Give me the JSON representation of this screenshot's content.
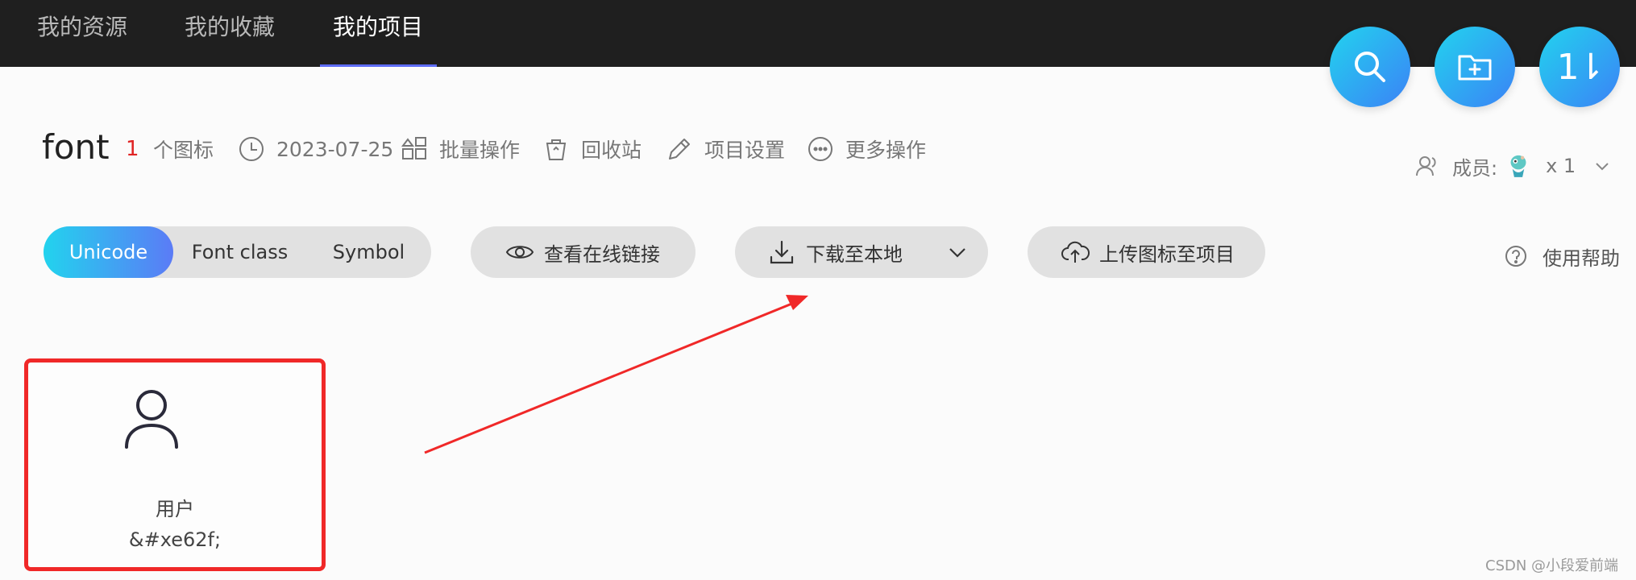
{
  "nav": {
    "tabs": [
      {
        "label": "我的资源"
      },
      {
        "label": "我的收藏"
      },
      {
        "label": "我的项目"
      }
    ],
    "active_tab": "我的项目"
  },
  "fabs": [
    {
      "icon": "search-icon"
    },
    {
      "icon": "add-folder-icon"
    },
    {
      "icon": "sort-icon",
      "glyph": "1⇂"
    }
  ],
  "project": {
    "name": "font",
    "icon_count": "1",
    "icon_count_unit": "个图标",
    "date": "2023-07-25",
    "batch_label": "批量操作",
    "recycle_label": "回收站",
    "settings_label": "项目设置",
    "more_label": "更多操作"
  },
  "members": {
    "label": "成员:",
    "count": "x 1"
  },
  "toolbar": {
    "segments": [
      "Unicode",
      "Font class",
      "Symbol"
    ],
    "active_segment": "Unicode",
    "view_link_label": "查看在线链接",
    "download_label": "下载至本地",
    "upload_label": "上传图标至项目",
    "help_label": "使用帮助"
  },
  "icons": [
    {
      "name": "用户",
      "code": "&#xe62f;",
      "icon": "user-icon"
    }
  ],
  "annotation": {
    "color": "#f02828"
  },
  "colors": {
    "accent_start": "#22d3ee",
    "accent_end": "#5b7bf6",
    "count_red": "#e02424"
  },
  "watermark": "CSDN @小段爱前端"
}
